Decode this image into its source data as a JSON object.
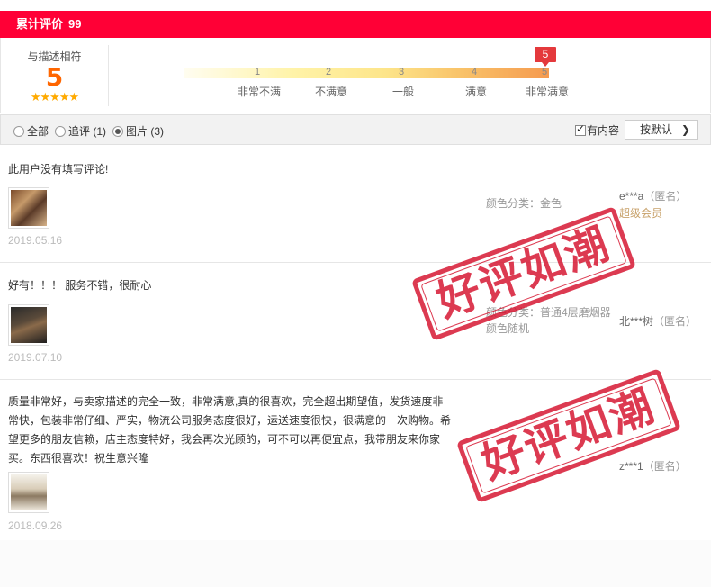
{
  "header": {
    "title": "累计评价",
    "count": "99"
  },
  "summary": {
    "label": "与描述相符",
    "score": "5",
    "stars": "★★★★★",
    "marker": "5",
    "ticks": [
      "1",
      "2",
      "3",
      "4",
      "5"
    ],
    "levels": [
      "非常不满",
      "不满意",
      "一般",
      "满意",
      "非常满意"
    ]
  },
  "filters": {
    "all": "全部",
    "append": "追评 (1)",
    "pictures": "图片 (3)",
    "has_content": "有内容",
    "sort": "按默认"
  },
  "reviews": [
    {
      "text": "此用户没有填写评论!",
      "date": "2019.05.16",
      "sku": "颜色分类：金色",
      "user": "e***a",
      "anon": "（匿名）",
      "member": "超级会员"
    },
    {
      "text": "好有！！！ 服务不错，很耐心",
      "date": "2019.07.10",
      "sku": "颜色分类：普通4层磨烟器颜色随机",
      "user": "北***树",
      "anon": "（匿名）"
    },
    {
      "text": "质量非常好，与卖家描述的完全一致，非常满意,真的很喜欢，完全超出期望值，发货速度非常快，包装非常仔细、严实，物流公司服务态度很好，运送速度很快，很满意的一次购物。希望更多的朋友信赖，店主态度特好，我会再次光顾的，可不可以再便宜点，我带朋友来你家买。东西很喜欢！祝生意兴隆",
      "date": "2018.09.26",
      "user": "z***1",
      "anon": "（匿名）"
    }
  ],
  "stamp_text": "好评如潮",
  "colors": {
    "accent": "#ff0036",
    "score": "#ff6600",
    "stamp": "#d5102c",
    "member": "#c8a26b"
  }
}
